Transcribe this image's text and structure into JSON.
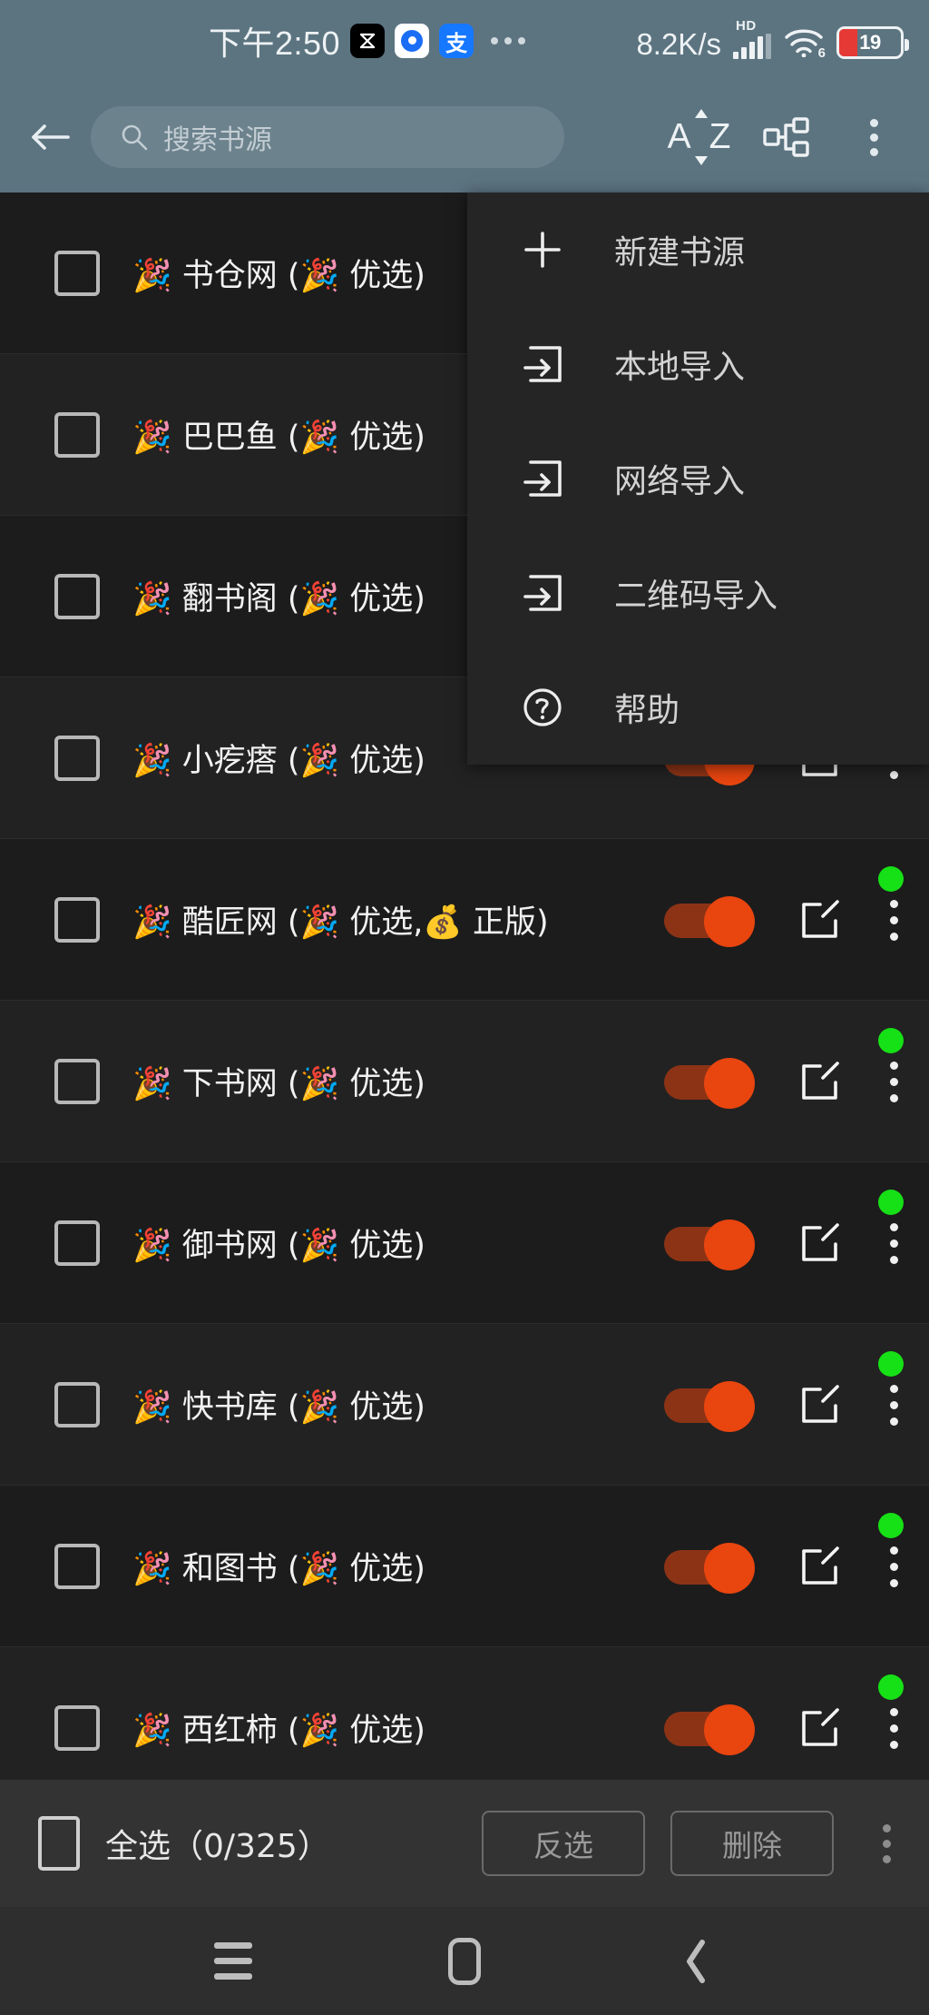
{
  "status_bar": {
    "time": "下午2:50",
    "app_icons": [
      "capcut-icon",
      "blue-circle-app-icon",
      "alipay-icon"
    ],
    "overflow": "…",
    "network_speed": "8.2K/s",
    "hd_label": "HD",
    "signal": "signal-bars-icon",
    "wifi": "wifi-icon",
    "wifi_generation": "6",
    "battery_percent": "19"
  },
  "toolbar": {
    "back_icon": "back-arrow-icon",
    "search_placeholder": "搜索书源",
    "search_value": "",
    "sort_label_a": "A",
    "sort_label_z": "Z",
    "sort_icon": "sort-az-icon",
    "group_icon": "group-tree-icon",
    "overflow_icon": "more-vertical-icon"
  },
  "menu": {
    "items": [
      {
        "label": "新建书源",
        "icon": "plus-icon"
      },
      {
        "label": "本地导入",
        "icon": "import-arrow-icon"
      },
      {
        "label": "网络导入",
        "icon": "import-arrow-icon"
      },
      {
        "label": "二维码导入",
        "icon": "import-arrow-icon"
      },
      {
        "label": "帮助",
        "icon": "help-circle-icon"
      }
    ]
  },
  "list": {
    "rows": [
      {
        "label": "🎉 书仓网 (🎉 优选)",
        "checked": false,
        "enabled": true,
        "online": true
      },
      {
        "label": "🎉 巴巴鱼 (🎉 优选)",
        "checked": false,
        "enabled": true,
        "online": true
      },
      {
        "label": "🎉 翻书阁 (🎉 优选)",
        "checked": false,
        "enabled": true,
        "online": true
      },
      {
        "label": "🎉 小疙瘩 (🎉 优选)",
        "checked": false,
        "enabled": true,
        "online": true
      },
      {
        "label": "🎉 酷匠网 (🎉 优选,💰 正版)",
        "checked": false,
        "enabled": true,
        "online": true
      },
      {
        "label": "🎉 下书网 (🎉 优选)",
        "checked": false,
        "enabled": true,
        "online": true
      },
      {
        "label": "🎉 御书网 (🎉 优选)",
        "checked": false,
        "enabled": true,
        "online": true
      },
      {
        "label": "🎉 快书库 (🎉 优选)",
        "checked": false,
        "enabled": true,
        "online": true
      },
      {
        "label": "🎉 和图书 (🎉 优选)",
        "checked": false,
        "enabled": true,
        "online": true
      },
      {
        "label": "🎉 西红柿 (🎉 优选)",
        "checked": false,
        "enabled": true,
        "online": true
      }
    ],
    "toggle_icon": "toggle-switch-on",
    "edit_icon": "edit-square-icon",
    "row_menu_icon": "more-vertical-icon",
    "online_badge_icon": "green-status-dot"
  },
  "bottom_bar": {
    "select_all_label": "全选（0/325）",
    "selected_count": "0",
    "total_count": "325",
    "invert_label": "反选",
    "delete_label": "删除",
    "overflow_icon": "more-vertical-icon"
  },
  "nav_bar": {
    "recents_icon": "hamburger-recents-icon",
    "home_icon": "home-pill-icon",
    "back_icon": "back-chevron-icon"
  },
  "colors": {
    "toolbar_bg": "#5c7480",
    "list_bg": "#1c1c1c",
    "row_alt_bg": "#222222",
    "menu_bg": "#252525",
    "bottom_bar_bg": "#333333",
    "nav_bar_bg": "#2e2e2e",
    "toggle_on": "#e8450f",
    "toggle_track": "#8c3316",
    "online_dot": "#16e016",
    "battery_low": "#e53935"
  }
}
